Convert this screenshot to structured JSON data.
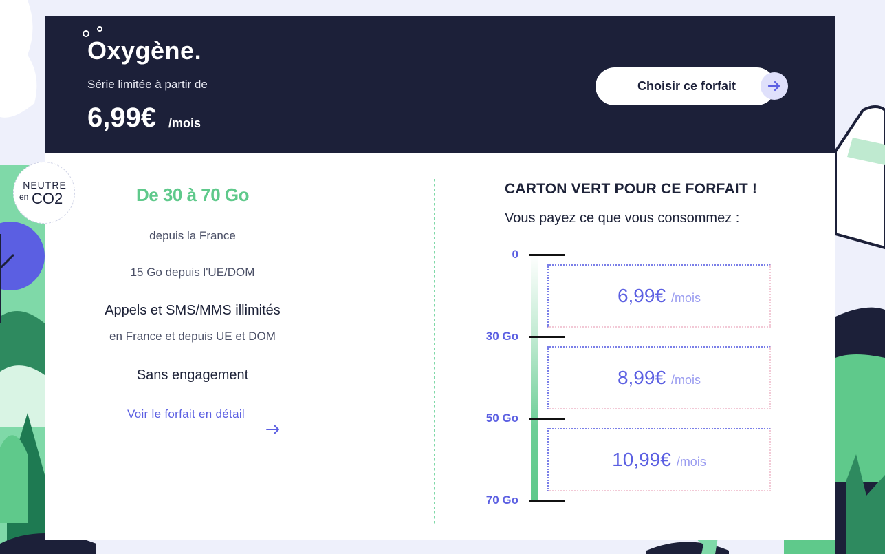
{
  "hero": {
    "brand": "Oxygène.",
    "subtitle": "Série limitée à partir de",
    "price": "6,99€",
    "price_unit": "/mois",
    "cta_label": "Choisir ce forfait"
  },
  "badge": {
    "top": "NEUTRE",
    "en": "en",
    "co2": "CO2"
  },
  "offer": {
    "data_range": "De 30 à 70 Go",
    "data_scope": "depuis la France",
    "eu_data": "15 Go depuis l'UE/DOM",
    "calls": "Appels et SMS/MMS illimités",
    "calls_scope": "en France et depuis UE et DOM",
    "commitment": "Sans engagement",
    "detail_link": "Voir le forfait en détail"
  },
  "pricing": {
    "title": "CARTON VERT POUR CE FORFAIT !",
    "subtitle": "Vous payez ce que vous consommez :",
    "scale": [
      "0",
      "30 Go",
      "50 Go",
      "70 Go"
    ],
    "tiers": [
      {
        "price": "6,99€",
        "unit": "/mois"
      },
      {
        "price": "8,99€",
        "unit": "/mois"
      },
      {
        "price": "10,99€",
        "unit": "/mois"
      }
    ]
  },
  "colors": {
    "navy": "#1c2039",
    "green": "#5fc98b",
    "accent": "#5b5fe2"
  },
  "icons": {
    "cta": "arrow-right-icon",
    "link": "arrow-right-icon"
  }
}
